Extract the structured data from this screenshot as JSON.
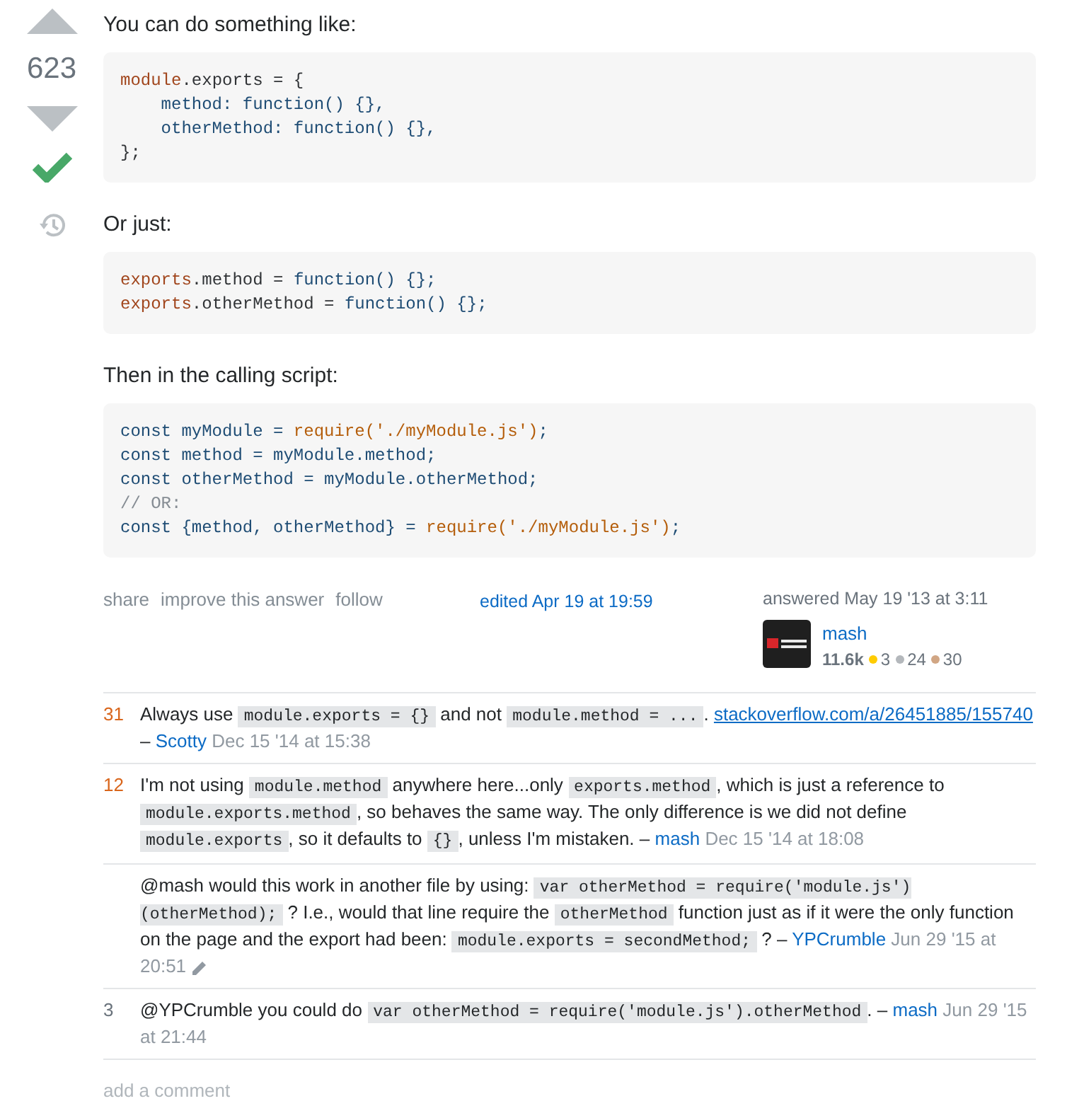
{
  "vote": {
    "score": "623",
    "accepted": true
  },
  "body": [
    {
      "kind": "paragraph",
      "text": "You can do something like:"
    },
    {
      "kind": "code",
      "lines": [
        [
          {
            "kind": "obj",
            "t": "module"
          },
          {
            "kind": "pl",
            "t": ".exports = {"
          }
        ],
        [
          {
            "kind": "kw",
            "t": "    method: function() {},"
          }
        ],
        [
          {
            "kind": "kw",
            "t": "    otherMethod: function() {},"
          }
        ],
        [
          {
            "kind": "pl",
            "t": "};"
          }
        ]
      ]
    },
    {
      "kind": "paragraph",
      "text": "Or just:"
    },
    {
      "kind": "code",
      "lines": [
        [
          {
            "kind": "obj",
            "t": "exports"
          },
          {
            "kind": "pl",
            "t": ".method = "
          },
          {
            "kind": "kw",
            "t": "function() {};"
          }
        ],
        [
          {
            "kind": "obj",
            "t": "exports"
          },
          {
            "kind": "pl",
            "t": ".otherMethod = "
          },
          {
            "kind": "kw",
            "t": "function() {};"
          }
        ]
      ]
    },
    {
      "kind": "paragraph",
      "text": "Then in the calling script:"
    },
    {
      "kind": "code",
      "lines": [
        [
          {
            "kind": "kw",
            "t": "const myModule = "
          },
          {
            "kind": "lit",
            "t": "require('./myModule.js')"
          },
          {
            "kind": "kw",
            "t": ";"
          }
        ],
        [
          {
            "kind": "kw",
            "t": "const method = myModule.method;"
          }
        ],
        [
          {
            "kind": "kw",
            "t": "const otherMethod = myModule.otherMethod;"
          }
        ],
        [
          {
            "kind": "com",
            "t": "// OR:"
          }
        ],
        [
          {
            "kind": "kw",
            "t": "const {method, otherMethod} = "
          },
          {
            "kind": "lit",
            "t": "require('./myModule.js')"
          },
          {
            "kind": "kw",
            "t": ";"
          }
        ]
      ]
    }
  ],
  "post_menu": [
    "share",
    "improve this answer",
    "follow"
  ],
  "edited": "edited Apr 19 at 19:59",
  "user": {
    "action": "answered May 19 '13 at 3:11",
    "name": "mash",
    "reputation": "11.6k",
    "badges": [
      {
        "count": "3",
        "color": "#ffcc01"
      },
      {
        "count": "24",
        "color": "#b4b8bc"
      },
      {
        "count": "30",
        "color": "#d1a684"
      }
    ]
  },
  "comments": [
    {
      "score": "31",
      "highlighted": true,
      "edited": false,
      "author": "Scotty",
      "date": "Dec 15 '14 at 15:38",
      "body": [
        {
          "kind": "text",
          "t": "Always use "
        },
        {
          "kind": "code",
          "t": "module.exports = {}"
        },
        {
          "kind": "text",
          "t": " and not "
        },
        {
          "kind": "code",
          "t": "module.method = ..."
        },
        {
          "kind": "text",
          "t": ". "
        },
        {
          "kind": "link",
          "t": "stackoverflow.com/a/26451885/155740"
        },
        {
          "kind": "text",
          "t": " – "
        }
      ]
    },
    {
      "score": "12",
      "highlighted": true,
      "edited": false,
      "author": "mash",
      "date": "Dec 15 '14 at 18:08",
      "body": [
        {
          "kind": "text",
          "t": "I'm not using "
        },
        {
          "kind": "code",
          "t": "module.method"
        },
        {
          "kind": "text",
          "t": " anywhere here...only "
        },
        {
          "kind": "code",
          "t": "exports.method"
        },
        {
          "kind": "text",
          "t": ", which is just a reference to "
        },
        {
          "kind": "code",
          "t": "module.exports.method"
        },
        {
          "kind": "text",
          "t": ", so behaves the same way. The only difference is we did not define "
        },
        {
          "kind": "code",
          "t": "module.exports"
        },
        {
          "kind": "text",
          "t": ", so it defaults to "
        },
        {
          "kind": "code",
          "t": "{}"
        },
        {
          "kind": "text",
          "t": ", unless I'm mistaken. – "
        }
      ]
    },
    {
      "highlighted": false,
      "edited": true,
      "author": "YPCrumble",
      "date": "Jun 29 '15 at 20:51",
      "body": [
        {
          "kind": "text",
          "t": "@mash would this work in another file by using: "
        },
        {
          "kind": "code",
          "t": "var otherMethod = require('module.js')(otherMethod);"
        },
        {
          "kind": "text",
          "t": " ? I.e., would that line require the "
        },
        {
          "kind": "code",
          "t": "otherMethod"
        },
        {
          "kind": "text",
          "t": " function just as if it were the only function on the page and the export had been: "
        },
        {
          "kind": "code",
          "t": "module.exports = secondMethod;"
        },
        {
          "kind": "text",
          "t": " ? – "
        }
      ]
    },
    {
      "score": "3",
      "highlighted": false,
      "edited": false,
      "author": "mash",
      "date": "Jun 29 '15 at 21:44",
      "body": [
        {
          "kind": "text",
          "t": "@YPCrumble you could do "
        },
        {
          "kind": "code",
          "t": "var otherMethod = require('module.js').otherMethod"
        },
        {
          "kind": "text",
          "t": ". – "
        }
      ]
    }
  ],
  "add_comment": "add a comment"
}
